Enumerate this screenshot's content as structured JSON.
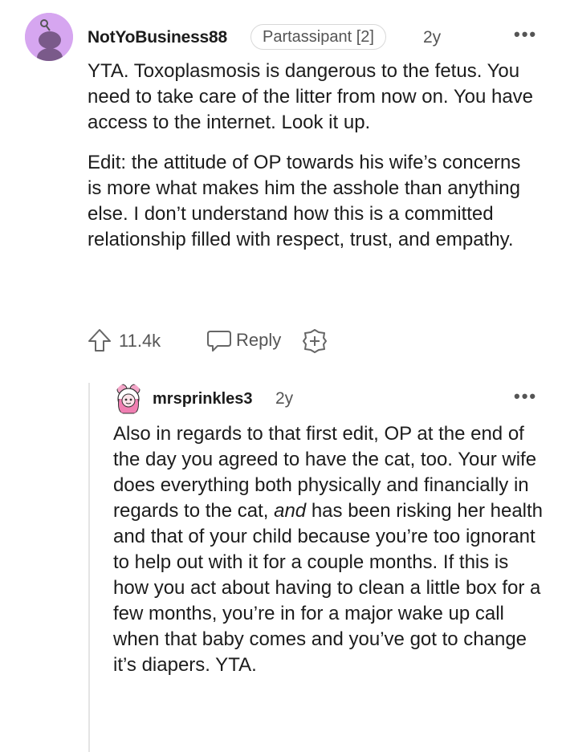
{
  "comment": {
    "username": "NotYoBusiness88",
    "flair": "Partassipant [2]",
    "age": "2y",
    "more": "•••",
    "paragraph1": "YTA. Toxoplasmosis is dangerous to the fetus. You need to take care of the litter from now on. You have access to the internet. Look it up.",
    "paragraph2": "Edit: the attitude of OP towards his wife’s concerns is more what makes him the asshole than anything else. I don’t understand how this is a committed relationship filled with respect, trust, and empathy.",
    "votes": "11.4k",
    "reply_label": "Reply"
  },
  "reply": {
    "username": "mrsprinkles3",
    "age": "2y",
    "more": "•••",
    "text_part1": "Also in regards to that first edit, OP at the end of the day you agreed to have the cat, too. Your wife does everything both physically and financially in regards to the cat, ",
    "text_emphasis": "and",
    "text_part2": " has been risking her health and that of your child because you’re too ignorant to help out with it for a couple months. If this is how you act about having to clean a little box for a few months, you’re in for a major wake up call when that baby comes and you’ve got to change it’s diapers. YTA."
  },
  "icons": {
    "avatar1": "snoo-avatar-icon",
    "upvote": "upvote-arrow-icon",
    "reply": "speech-bubble-icon",
    "award": "award-plus-icon",
    "avatar2": "user-avatar-icon"
  },
  "colors": {
    "avatar_bg": "#d6a6f0",
    "text": "#1c1c1c",
    "muted": "#555555",
    "thread_line": "#e4e4e4"
  }
}
